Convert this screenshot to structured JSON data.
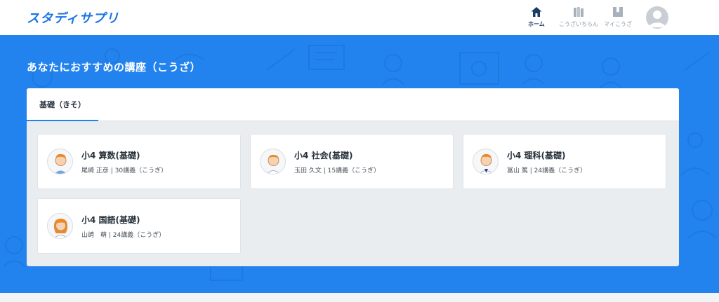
{
  "header": {
    "logo": "スタディサプリ",
    "nav": [
      {
        "label": "ホーム",
        "icon": "home-icon",
        "active": true
      },
      {
        "label": "こうざいちらん",
        "icon": "books-icon",
        "active": false
      },
      {
        "label": "マイこうざ",
        "icon": "bookmark-book-icon",
        "active": false
      }
    ],
    "avatar_icon": "user-avatar-icon"
  },
  "hero": {
    "title": "あなたにおすすめの講座（こうざ）",
    "background_color": "#2383ee"
  },
  "tabs": [
    {
      "label": "基礎（きそ）",
      "active": true
    }
  ],
  "courses": [
    {
      "title": "小4 算数(基礎)",
      "meta": "尾崎 正彦 | 30講義（こうぎ）",
      "icon": "teacher-avatar-icon"
    },
    {
      "title": "小4 社会(基礎)",
      "meta": "玉田 久文 | 15講義（こうぎ）",
      "icon": "teacher-avatar-icon"
    },
    {
      "title": "小4 理科(基礎)",
      "meta": "冨山 篤 | 24講義（こうぎ）",
      "icon": "teacher-avatar-icon"
    },
    {
      "title": "小4 国語(基礎)",
      "meta": "山崎　萌 | 24講義（こうぎ）",
      "icon": "teacher-avatar-icon"
    }
  ],
  "colors": {
    "accent": "#2383ee",
    "active_nav": "#1c3a63",
    "inactive_nav": "#8f9aa6"
  }
}
